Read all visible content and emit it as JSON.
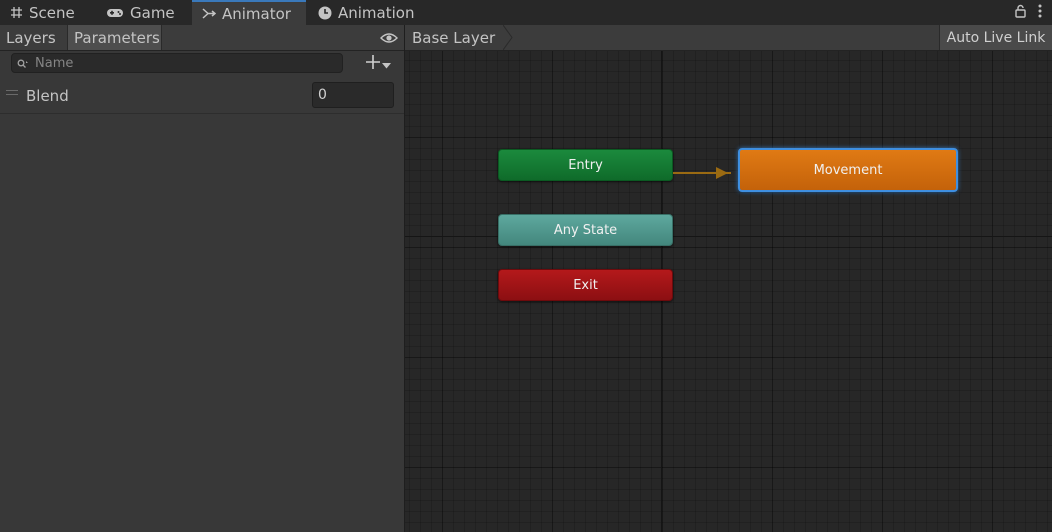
{
  "tabs": [
    {
      "label": "Scene",
      "icon": "grid-icon"
    },
    {
      "label": "Game",
      "icon": "gamepad-icon"
    },
    {
      "label": "Animator",
      "icon": "animator-icon",
      "active": true
    },
    {
      "label": "Animation",
      "icon": "clock-icon"
    }
  ],
  "left_panel": {
    "tabs": [
      "Layers",
      "Parameters"
    ],
    "selected_tab": "Parameters",
    "search": {
      "placeholder": "Name",
      "value": ""
    },
    "parameters": [
      {
        "name": "Blend",
        "value": "0"
      }
    ]
  },
  "graph": {
    "breadcrumb": "Base Layer",
    "live_link_label": "Auto Live Link",
    "nodes": {
      "entry": "Entry",
      "any_state": "Any State",
      "exit": "Exit",
      "movement": "Movement"
    }
  },
  "colors": {
    "entry": "#1b8a3d",
    "any_state": "#5ea89e",
    "exit": "#b4191b",
    "movement": "#e07a14",
    "selection": "#3f8fe0",
    "transition": "#9a6a12"
  }
}
